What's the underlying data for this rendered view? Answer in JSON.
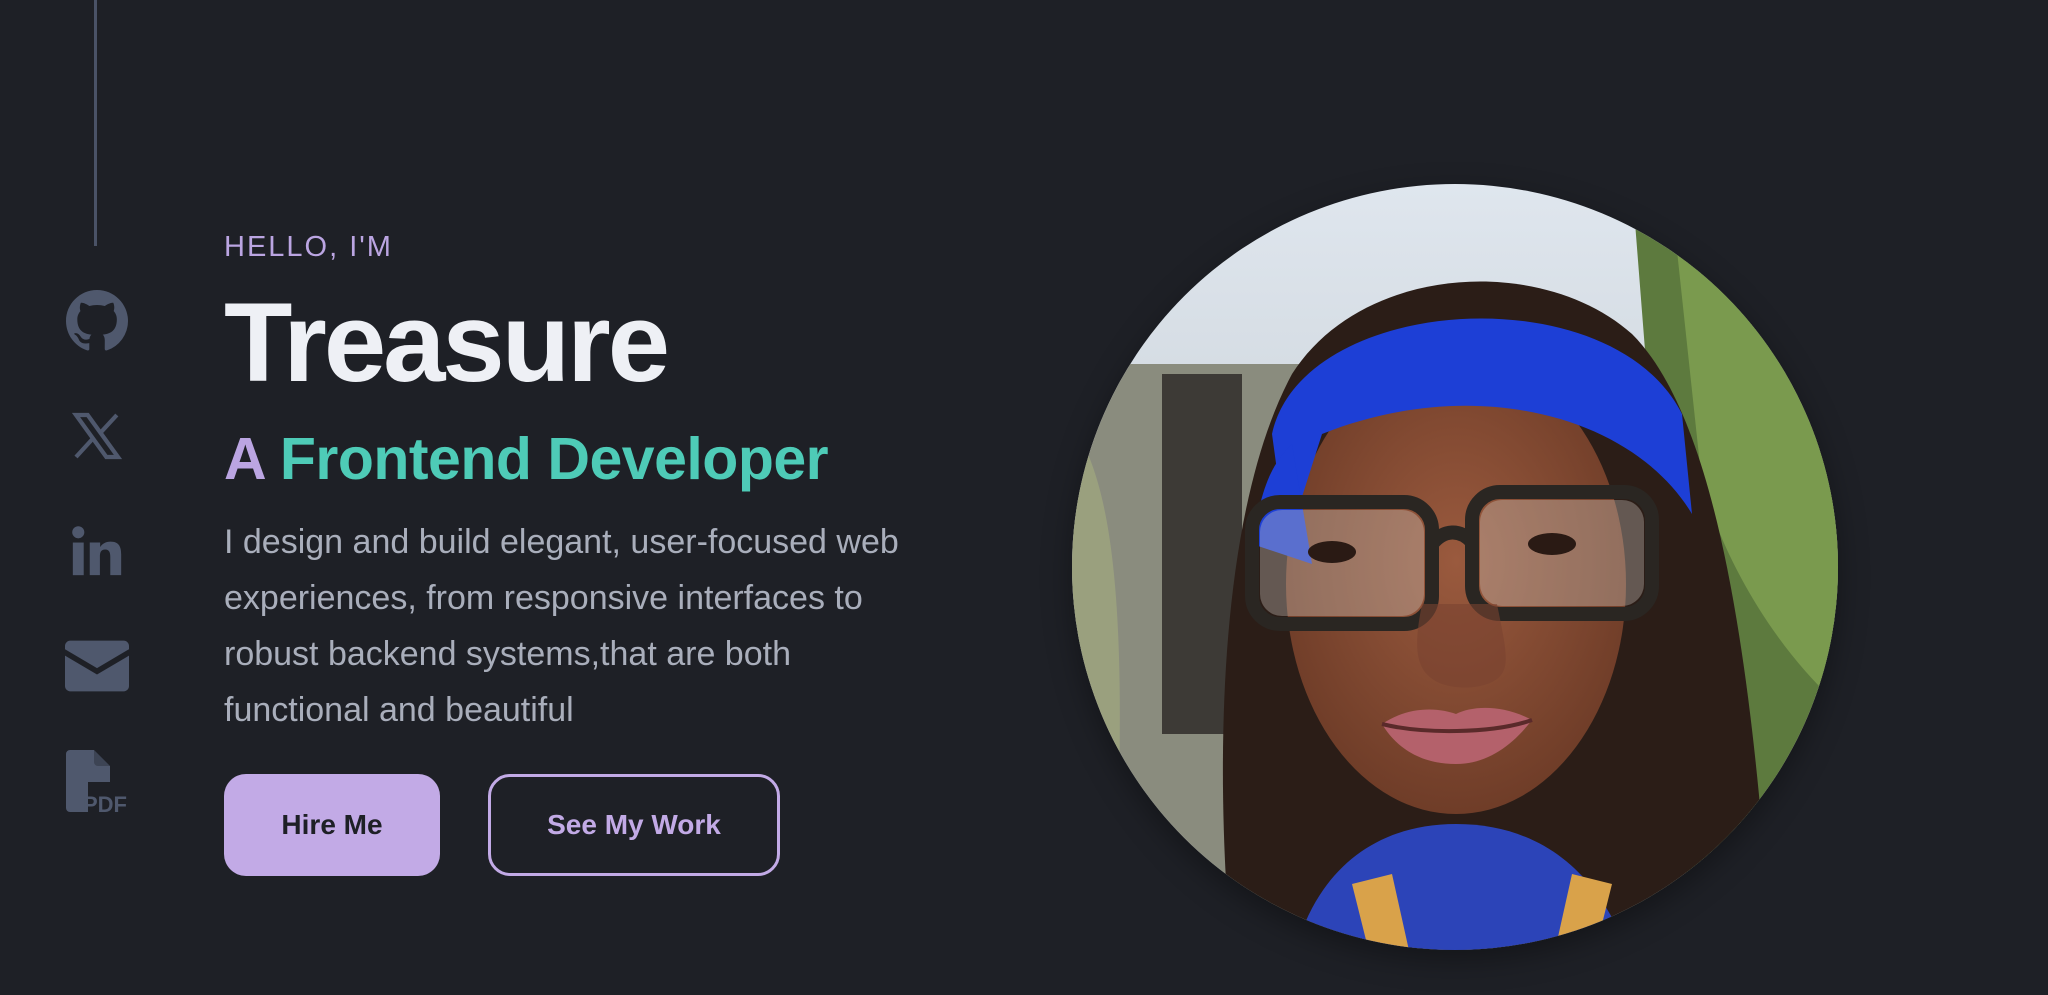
{
  "hero": {
    "greeting": "HELLO, I'M",
    "name": "Treasure",
    "role_article": "A",
    "role_title": "Frontend Developer",
    "description": "I design and build elegant, user-focused web experiences, from responsive interfaces to robust backend systems,that are both functional and beautiful",
    "primary_button": "Hire Me",
    "secondary_button": "See My Work"
  },
  "socials": [
    {
      "icon": "github-icon"
    },
    {
      "icon": "x-twitter-icon"
    },
    {
      "icon": "linkedin-icon"
    },
    {
      "icon": "email-icon"
    },
    {
      "icon": "pdf-resume-icon",
      "label": "PDF"
    }
  ],
  "colors": {
    "background": "#1e2026",
    "accent_lavender": "#c2aae6",
    "accent_teal": "#4ecbb7",
    "heading": "#eef0f5",
    "body_text": "#a9aebb",
    "icon_muted": "#4f586d"
  }
}
